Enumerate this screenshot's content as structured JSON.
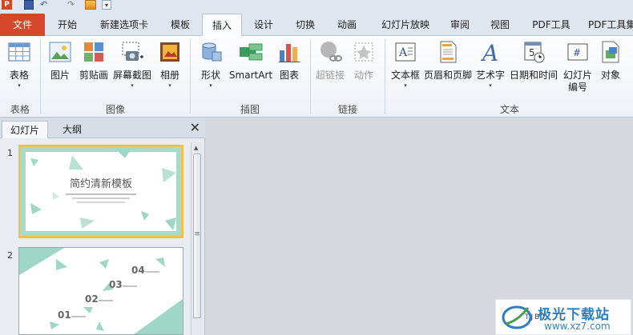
{
  "quick_access": {
    "app_badge": "P",
    "undo_glyph": "↶",
    "redo_glyph": "↷",
    "customize_glyph": "▾"
  },
  "tabs": [
    {
      "label": "文件"
    },
    {
      "label": "开始"
    },
    {
      "label": "新建选项卡"
    },
    {
      "label": "模板"
    },
    {
      "label": "插入"
    },
    {
      "label": "设计"
    },
    {
      "label": "切换"
    },
    {
      "label": "动画"
    },
    {
      "label": "幻灯片放映"
    },
    {
      "label": "审阅"
    },
    {
      "label": "视图"
    },
    {
      "label": "PDF工具"
    },
    {
      "label": "PDF工具集"
    }
  ],
  "active_tab": "插入",
  "ribbon": {
    "groups": [
      {
        "label": "表格"
      },
      {
        "label": "图像"
      },
      {
        "label": "插图"
      },
      {
        "label": "链接"
      },
      {
        "label": "文本"
      }
    ],
    "buttons": {
      "table": "表格",
      "picture": "图片",
      "clipart": "剪贴画",
      "screenshot": "屏幕截图",
      "album": "相册",
      "shapes": "形状",
      "smartart": "SmartArt",
      "chart": "图表",
      "hyperlink": "超链接",
      "action": "动作",
      "textbox": "文本框",
      "header_footer": "页眉和页脚",
      "wordart": "艺术字",
      "datetime": "日期和时间",
      "slide_number_1": "幻灯片",
      "slide_number_2": "编号",
      "object": "对象"
    },
    "dropdown_arrow": "▾"
  },
  "panel": {
    "tabs": [
      {
        "label": "幻灯片"
      },
      {
        "label": "大纲"
      }
    ],
    "close_glyph": "✕",
    "slides": [
      {
        "number": "1",
        "title": "简约清新模板"
      },
      {
        "number": "2",
        "labels": [
          "04",
          "03",
          "02",
          "01"
        ]
      }
    ]
  },
  "watermark": {
    "name": "极光下载站",
    "url": "www.xz7.com",
    "latin": "TJBT"
  },
  "colors": {
    "accent_mint": "#9ed7c5",
    "file_tab": "#d6472b",
    "selection": "#f0c24b"
  }
}
